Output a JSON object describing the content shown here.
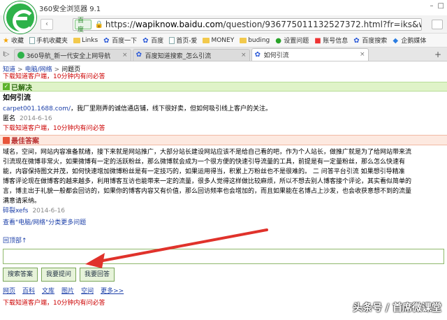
{
  "browser": {
    "app_title": "360安全浏览器 9.1",
    "engine_badge": "百度",
    "url_prefix": "https://",
    "url_host": "wapiknow.baidu.com",
    "url_path": "/question/936775011132527372.html?fr=iks&word=h",
    "favorites": [
      {
        "label": "收藏",
        "icon": "star-icon"
      },
      {
        "label": "手机收藏夹",
        "icon": "page-icon"
      },
      {
        "label": "Links",
        "icon": "folder-icon"
      },
      {
        "label": "百度一下",
        "icon": "paw-icon"
      },
      {
        "label": "百度",
        "icon": "paw-icon"
      },
      {
        "label": "首页-爱",
        "icon": "page-icon"
      },
      {
        "label": "MONEY",
        "icon": "folder-icon"
      },
      {
        "label": "buding",
        "icon": "folder-icon"
      },
      {
        "label": "设置问题",
        "icon": "green-icon"
      },
      {
        "label": "账号信息",
        "icon": "red-icon"
      },
      {
        "label": "百度搜索",
        "icon": "paw-icon"
      },
      {
        "label": "企鹅媒体",
        "icon": "blue-icon"
      }
    ],
    "tabs": [
      {
        "label": "360导航_新一代安全上网导航",
        "icon": "360-icon",
        "active": false
      },
      {
        "label": "百度知道搜索_怎么引流",
        "icon": "paw-icon",
        "active": false
      },
      {
        "label": "如何引流",
        "icon": "paw-icon",
        "active": true
      }
    ]
  },
  "page": {
    "breadcrumb": [
      "知道",
      "电脑/网络",
      "问题页"
    ],
    "client_link": "下载知道客户端，10分钟内有问必答",
    "status_label": "已解决",
    "question": {
      "title": "如何引流",
      "link_text": "carpet001.1688.com/",
      "body": "，我厂里刚弄的诚信通店铺，线下很好卖，但如何吸引线上客户的关注。",
      "author": "匿名",
      "date": "2014-6-16"
    },
    "best_answer_label": "最佳答案",
    "answer_lines": [
      "域名，空间，网站内容准备就绪，接下来就是网站推广，大部分站长建设网站应该不是给自己看的吧，作为个人站长，做推广就是为了给网站带来流",
      "引流现在微博非常火，如果微博有一定的活跃粉丝，那么微博就会成为一个很方便的快速引导流量的工具，前提是有一定量粉丝，那么怎么快速有",
      "能，内容保持图文并茂，如何快速增加微博粉丝是有一定技巧的，如果运用得当，积累上万粉丝也不是很难的。 二 问答平台引流 如果想引导精准",
      "博客评论现在做博客的越来越多，利用博客互访也能带来一定的流量，很多人觉得这样做比较麻烦，所以不想去别人博客接个评论，其实看似简单的",
      "言，博主出于礼貌一般都会回访的，如果你的博客内容又有价值，那么回访频率也会增加的，而且如果能在名博占上沙发，也会收获意想不到的流量",
      "满意请采纳。"
    ],
    "answer_author": "碎裂xefs",
    "answer_date": "2014-6-16",
    "more_link": "查看\"电脑/网络\"分类更多问题",
    "back_top": "回顶部↑",
    "reply_placeholder": "",
    "action_buttons": [
      "搜索答案",
      "我要提问",
      "我要回答"
    ],
    "bottom_links": [
      "网页",
      "百科",
      "文库",
      "图片",
      "空间",
      "更多>>"
    ],
    "footer_link": "下载知道客户端，10分钟内有问必答"
  },
  "watermark": "头条号 / 首席微课堂",
  "colors": {
    "solved_bar": "#dff3c8",
    "best_bar": "#fde9e0",
    "link": "#1a3ea8",
    "red_link": "#cc0000",
    "arrow": "#e0322b"
  }
}
